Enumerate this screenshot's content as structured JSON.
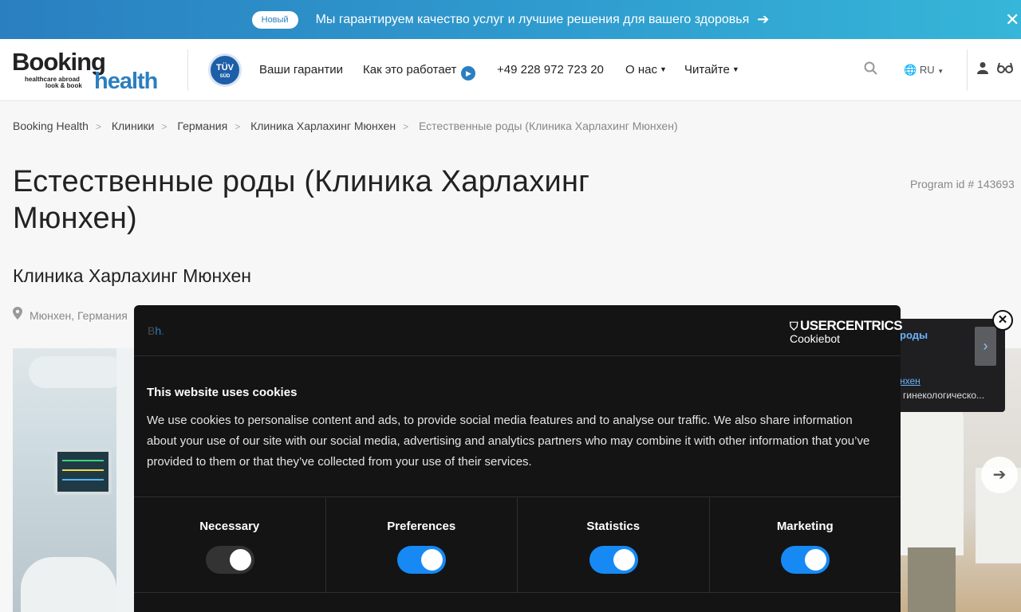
{
  "announcement": {
    "badge": "Новый",
    "message": "Мы гарантируем качество услуг и лучшие решения для вашего здоровья",
    "arrow_icon": "arrow-right-icon",
    "close_icon": "close-icon"
  },
  "header": {
    "logo": {
      "word1": "Booking",
      "word2": "health",
      "tagline1": "healthcare abroad",
      "tagline2": "look & book"
    },
    "tuv_badge": {
      "text": "TÜV",
      "sub": "SÜD"
    },
    "nav": [
      {
        "label": "Ваши гарантии"
      },
      {
        "label": "Как это работает"
      },
      {
        "label": "+49 228 972 723 20"
      },
      {
        "label": "О нас"
      },
      {
        "label": "Читайте"
      }
    ],
    "language": "RU"
  },
  "breadcrumb": [
    "Booking Health",
    "Клиники",
    "Германия",
    "Клиника Харлахинг Мюнхен",
    "Естественные роды (Клиника Харлахинг Мюнхен)"
  ],
  "page": {
    "title": "Естественные роды (Клиника Харлахинг Мюнхен)",
    "program_id": "Program id # 143693",
    "clinic_name": "Клиника Харлахинг Мюнхен",
    "location": "Мюнхен, Германия"
  },
  "popup": {
    "title_fragment": "роды",
    "link_fragment": "нхен",
    "text_fragment": "гинекологическо..."
  },
  "cookie_dialog": {
    "brand_short": "Bh.",
    "provider": "USERCENTRICS",
    "provider_sub": "Cookiebot",
    "heading": "This website uses cookies",
    "body": "We use cookies to personalise content and ads, to provide social media features and to analyse our traffic. We also share information about your use of our site with our social media, advertising and analytics partners who may combine it with other information that you’ve provided to them or that they’ve collected from your use of their services.",
    "categories": [
      {
        "label": "Necessary",
        "enabled": true,
        "locked": true
      },
      {
        "label": "Preferences",
        "enabled": true
      },
      {
        "label": "Statistics",
        "enabled": true
      },
      {
        "label": "Marketing",
        "enabled": true
      }
    ]
  },
  "colors": {
    "brand_blue": "#2a7fc0",
    "toggle_on": "#1689f5",
    "dialog_bg": "#141414"
  }
}
